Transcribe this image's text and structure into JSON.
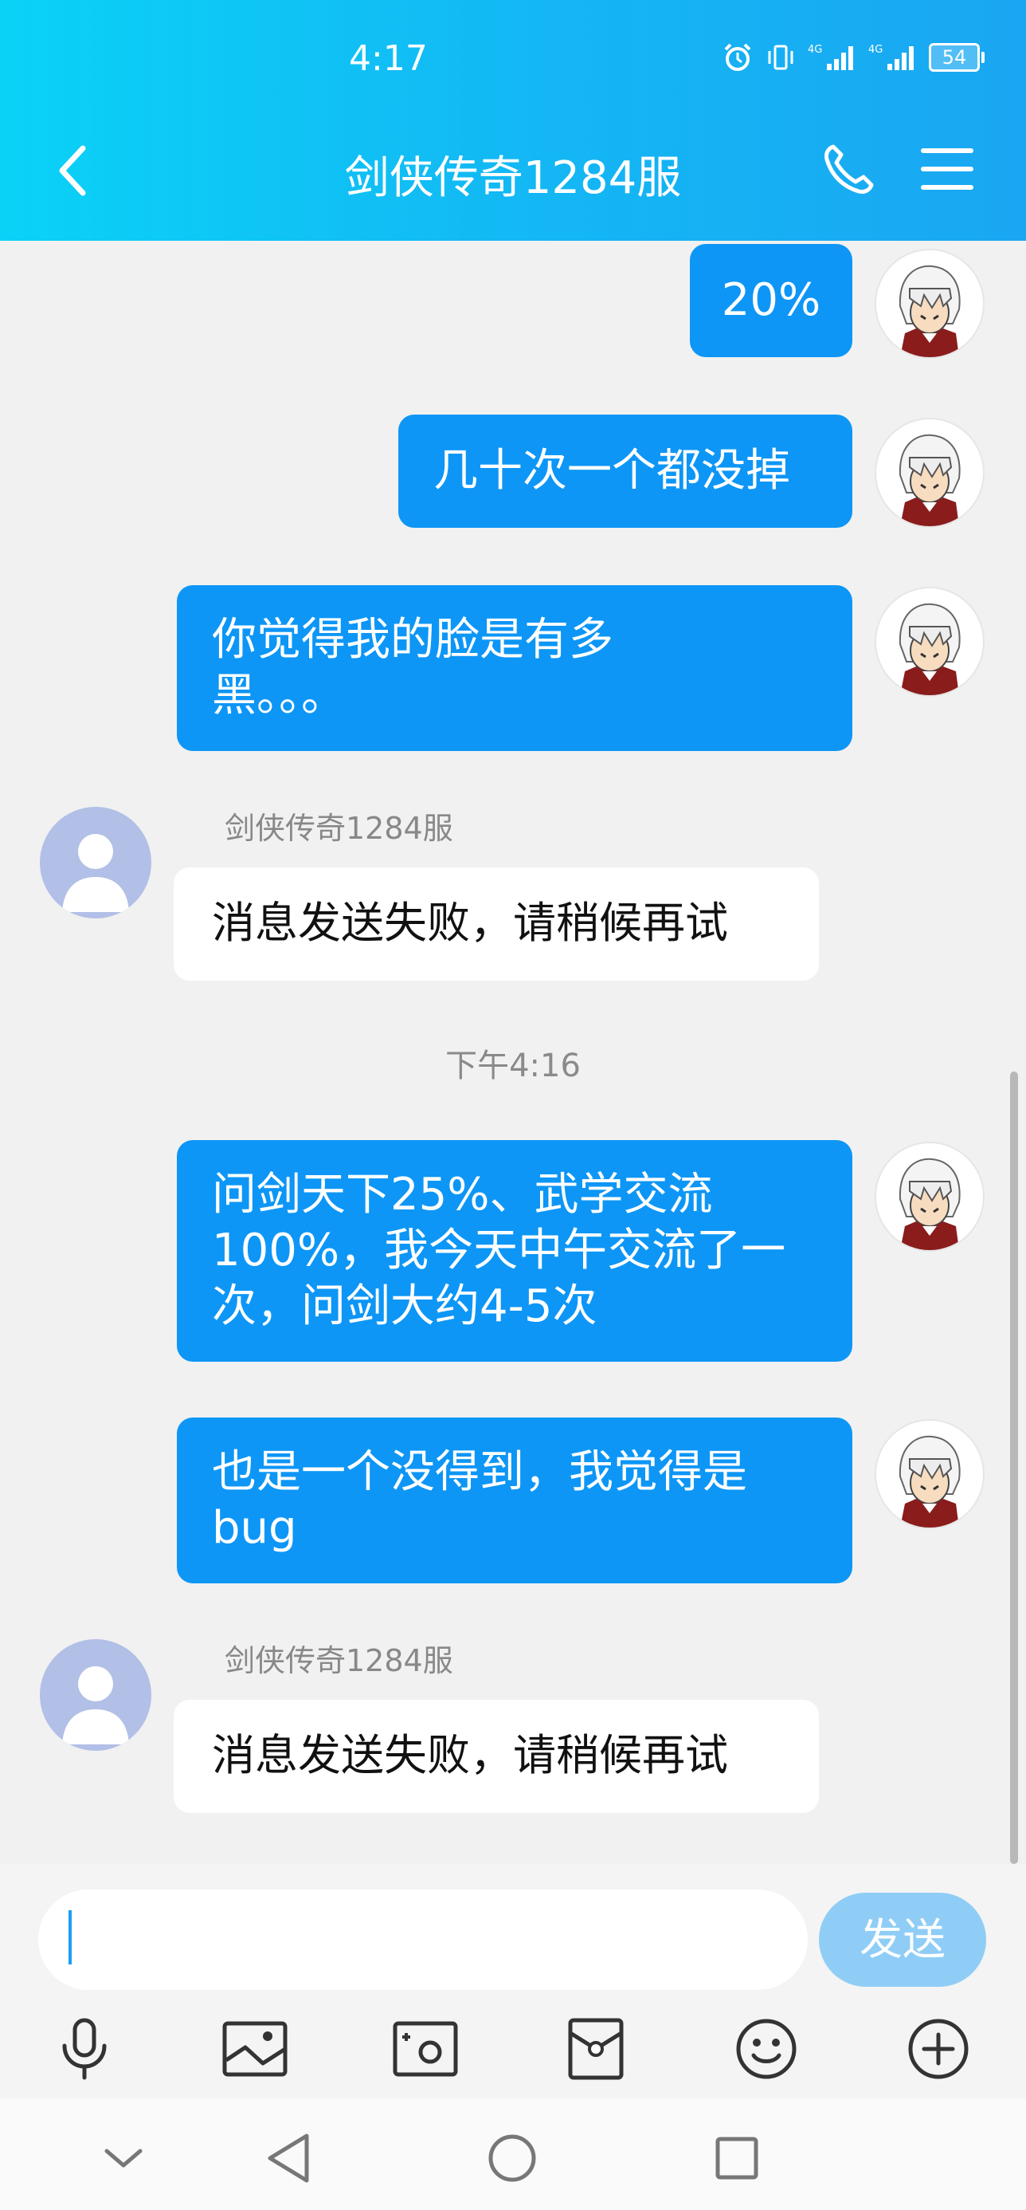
{
  "status_bar": {
    "time": "4:17",
    "battery": "54"
  },
  "header": {
    "title": "剑侠传奇1284服"
  },
  "messages": [
    {
      "text": "20%"
    },
    {
      "text": "几十次一个都没掉"
    },
    {
      "line1": "你觉得我的脸是有多",
      "line2": "黑。。。"
    },
    {
      "sender": "剑侠传奇1284服",
      "text": "消息发送失败，请稍候再试"
    },
    {
      "time": "下午4:16"
    },
    {
      "line1": "问剑天下25%、武学交流",
      "line2": "100%，我今天中午交流了一",
      "line3": "次，问剑大约4-5次"
    },
    {
      "line1": "也是一个没得到，我觉得是",
      "line2": "bug"
    },
    {
      "sender": "剑侠传奇1284服",
      "text": "消息发送失败，请稍候再试"
    }
  ],
  "input": {
    "value": "",
    "send_label": "发送"
  },
  "toolbar_icons": [
    "microphone-icon",
    "image-icon",
    "camera-icon",
    "red-packet-icon",
    "emoji-icon",
    "plus-icon"
  ],
  "colors": {
    "header_start": "#0ad2f7",
    "header_end": "#1aa6f2",
    "bubble_out": "#0d96f6",
    "send_disabled": "#8fcdf6"
  }
}
